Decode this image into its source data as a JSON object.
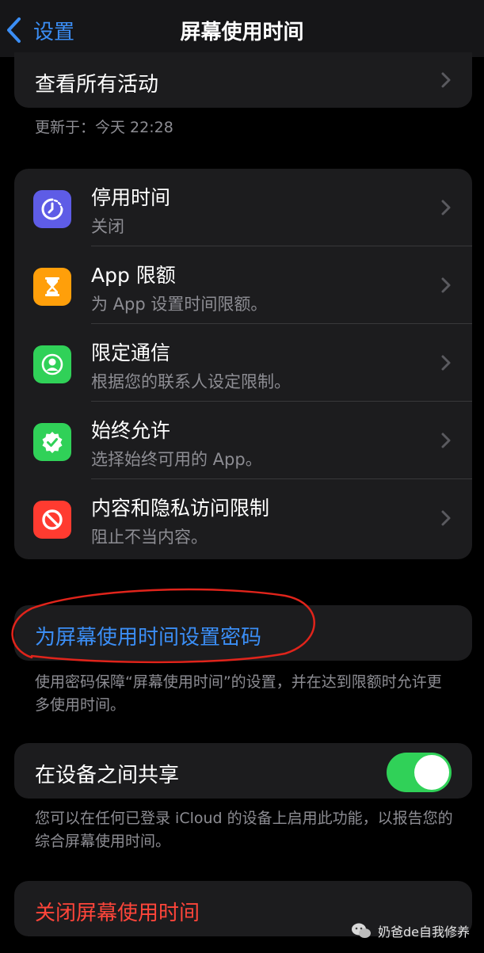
{
  "nav": {
    "back_label": "设置",
    "title": "屏幕使用时间"
  },
  "activity": {
    "label": "查看所有活动",
    "updated": "更新于：今天 22:28"
  },
  "rows": [
    {
      "title": "停用时间",
      "subtitle": "关闭",
      "icon": "downtime-icon",
      "color": "#5e5ce6"
    },
    {
      "title": "App 限额",
      "subtitle": "为 App 设置时间限额。",
      "icon": "hourglass-icon",
      "color": "#ff9f0a"
    },
    {
      "title": "限定通信",
      "subtitle": "根据您的联系人设定限制。",
      "icon": "contact-icon",
      "color": "#30d158"
    },
    {
      "title": "始终允许",
      "subtitle": "选择始终可用的 App。",
      "icon": "checkmark-badge-icon",
      "color": "#30d158"
    },
    {
      "title": "内容和隐私访问限制",
      "subtitle": "阻止不当内容。",
      "icon": "no-entry-icon",
      "color": "#ff3b30"
    }
  ],
  "passcode": {
    "label": "为屏幕使用时间设置密码",
    "footnote": "使用密码保障“屏幕使用时间”的设置，并在达到限额时允许更多使用时间。",
    "color": "#3b8ef5"
  },
  "share": {
    "label": "在设备之间共享",
    "enabled": true,
    "footnote": "您可以在任何已登录 iCloud 的设备上启用此功能，以报告您的综合屏幕使用时间。"
  },
  "turn_off": {
    "label": "关闭屏幕使用时间",
    "color": "#ff453a"
  },
  "watermark": {
    "text": "奶爸de自我修养"
  }
}
